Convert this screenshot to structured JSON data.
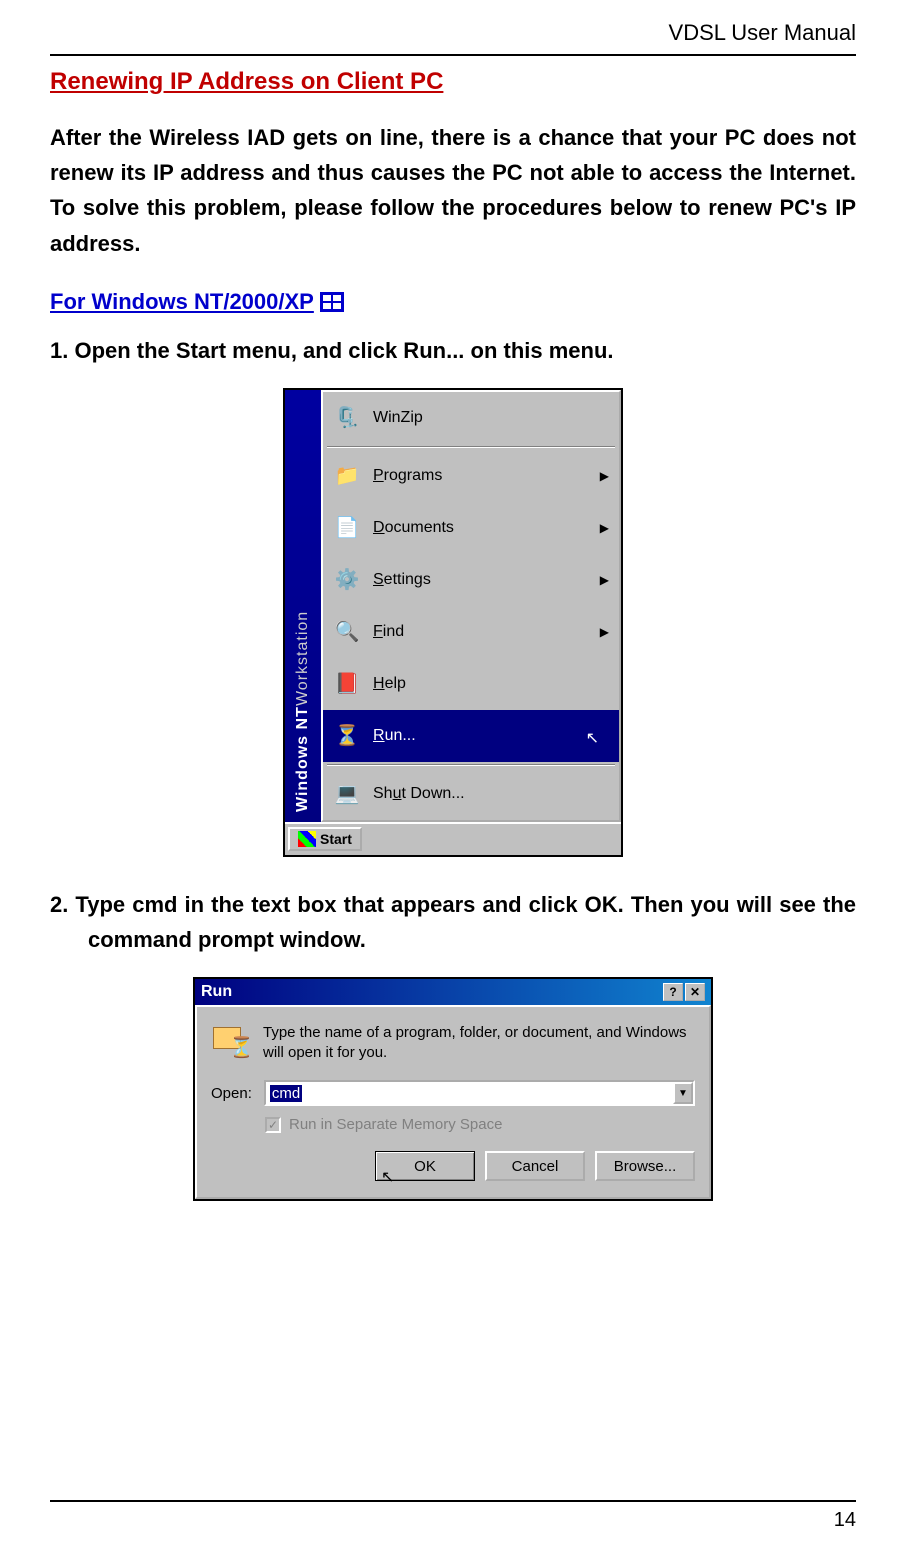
{
  "header": {
    "doc_title": "VDSL User Manual"
  },
  "section": {
    "title": "Renewing IP Address on Client PC"
  },
  "intro": "After the Wireless IAD gets on line, there is a chance that your PC does not renew its IP address and thus causes the PC not able to access the Internet. To solve this problem, please follow the procedures below to renew PC's IP address.",
  "subsection": {
    "title": "For Windows NT/2000/XP"
  },
  "step1": "1.    Open the Start menu, and click Run... on this menu.",
  "step2": "2.    Type cmd in the text box that appears and click OK. Then you will see the command prompt window.",
  "start_menu": {
    "sidebar_bold": "Windows NT",
    "sidebar_light": " Workstation",
    "items": [
      {
        "label": "WinZip",
        "has_sub": false
      },
      {
        "label": "Programs",
        "underline": "P",
        "rest": "rograms",
        "has_sub": true
      },
      {
        "label": "Documents",
        "underline": "D",
        "rest": "ocuments",
        "has_sub": true
      },
      {
        "label": "Settings",
        "underline": "S",
        "rest": "ettings",
        "has_sub": true
      },
      {
        "label": "Find",
        "underline": "F",
        "rest": "ind",
        "has_sub": true
      },
      {
        "label": "Help",
        "underline": "H",
        "rest": "elp",
        "has_sub": false
      },
      {
        "label": "Run...",
        "underline": "R",
        "rest": "un...",
        "has_sub": false,
        "selected": true
      },
      {
        "label": "Shut Down...",
        "underline": "u",
        "pre": "Sh",
        "rest": "t Down...",
        "has_sub": false
      }
    ],
    "start_label": "Start"
  },
  "run_dialog": {
    "title": "Run",
    "description": "Type the name of a program, folder, or document, and Windows will open it for you.",
    "open_label": "Open:",
    "open_underline": "O",
    "open_rest": "pen:",
    "input_value": "cmd",
    "checkbox_label": "Run in Separate Memory Space",
    "checkbox_underline": "M",
    "checkbox_pre": "Run in Separate ",
    "checkbox_rest": "emory Space",
    "buttons": {
      "ok": "OK",
      "cancel": "Cancel",
      "browse": "Browse...",
      "browse_underline": "B",
      "browse_rest": "rowse..."
    }
  },
  "page_number": "14"
}
